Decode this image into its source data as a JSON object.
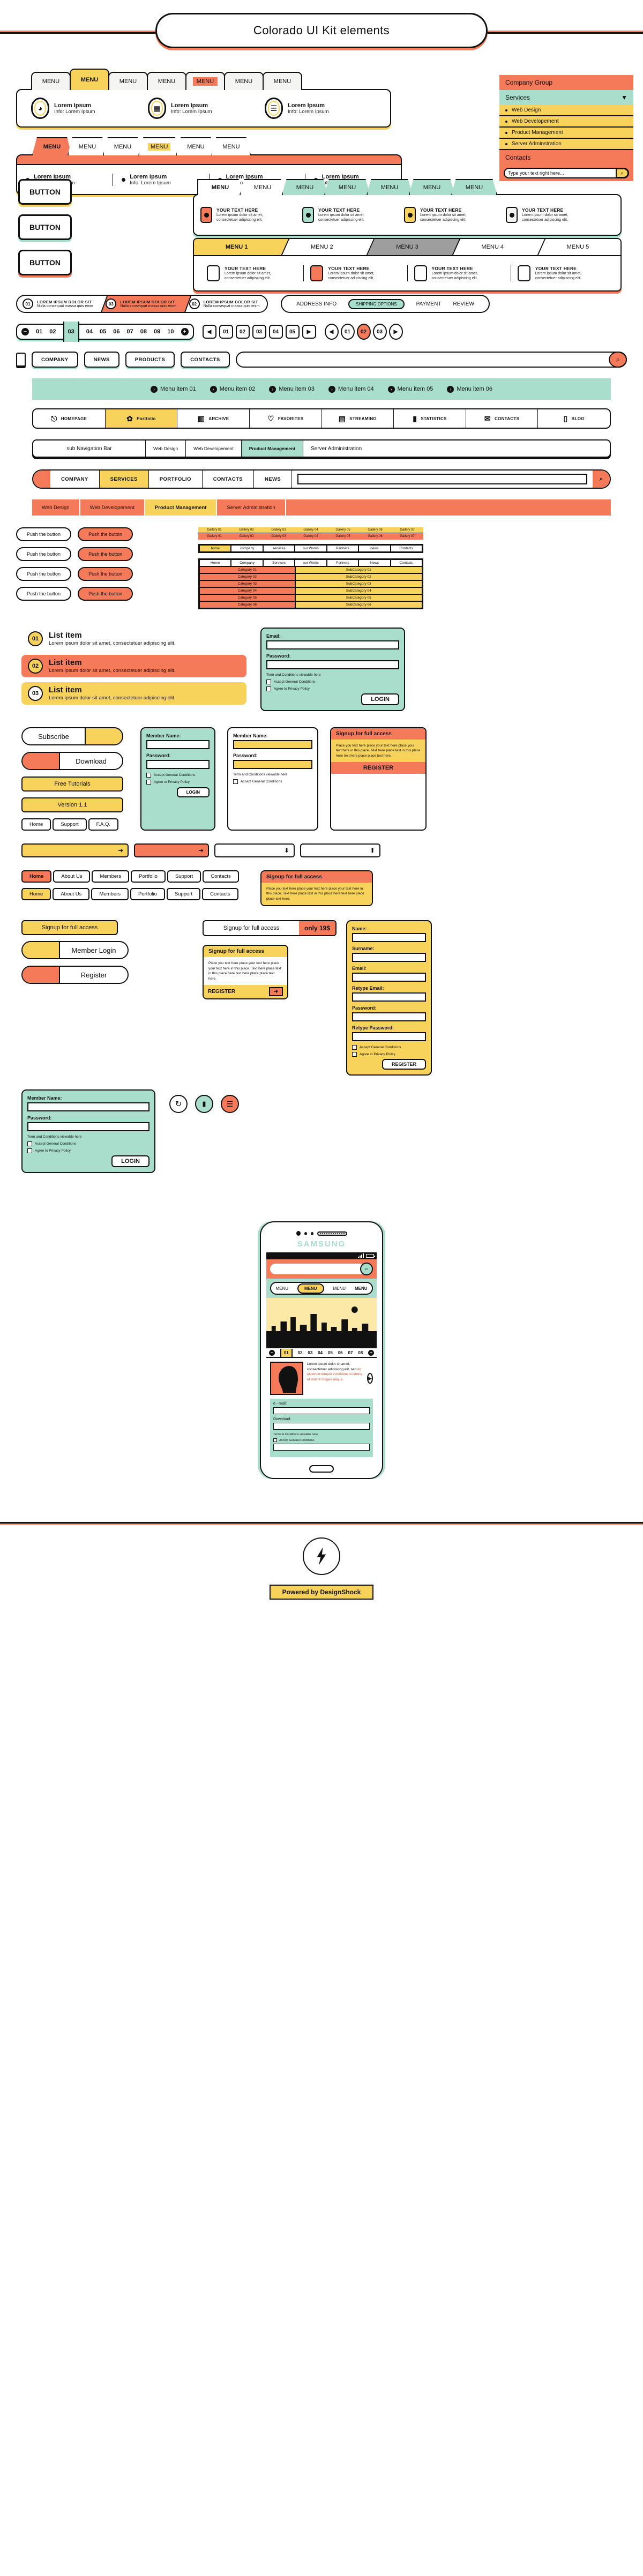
{
  "header": {
    "title": "Colorado UI Kit elements"
  },
  "menu_tabs_yellow": {
    "tabs": [
      "MENU",
      "MENU",
      "MENU",
      "MENU",
      "MENU",
      "MENU",
      "MENU"
    ],
    "selected_index": 1,
    "highlight_index": 4,
    "features": [
      {
        "title": "Lorem Ipsum",
        "info": "Info: Lorem Ipsum",
        "icon": "pie-chart-icon"
      },
      {
        "title": "Lorem Ipsum",
        "info": "Info: Lorem Ipsum",
        "icon": "bar-chart-icon"
      },
      {
        "title": "Lorem Ipsum",
        "info": "Info: Lorem Ipsum",
        "icon": "list-icon"
      }
    ]
  },
  "menu_tabs_orange": {
    "tabs": [
      "MENU",
      "MENU",
      "MENU",
      "MENU",
      "MENU",
      "MENU"
    ],
    "selected_index": 0,
    "highlight_index": 3,
    "features": [
      {
        "title": "Lorem Ipsum",
        "info": "Info: Lorem Ipsum"
      },
      {
        "title": "Lorem Ipsum",
        "info": "Info: Lorem Ipsum"
      },
      {
        "title": "Lorem Ipsum",
        "info": "Info: Lorem Ipsum"
      },
      {
        "title": "Lorem Ipsum",
        "info": "Info: Lorem Ipsum"
      }
    ]
  },
  "company_group": {
    "header": "Company Group",
    "select_label": "Services",
    "options": [
      "Web Design",
      "Web Developement",
      "Product Management",
      "Server Adminstration"
    ],
    "contacts_label": "Contacts",
    "search_placeholder": "Type your text right here..."
  },
  "buttons": {
    "labels": [
      "BUTTON",
      "BUTTON",
      "BUTTON"
    ]
  },
  "menu_tabs_green": {
    "tabs": [
      "MENU",
      "MENU",
      "MENU",
      "MENU",
      "MENU",
      "MENU",
      "MENU"
    ],
    "cells": [
      {
        "heading": "YOUR TEXT HERE",
        "body": "Lorem ipsum dolor sit amet, consectetuer adipiscing elit.",
        "color": "#F47A5A"
      },
      {
        "heading": "YOUR TEXT HERE",
        "body": "Lorem ipsum dolor sit amet, consectetuer adipiscing elit.",
        "color": "#A8DECB"
      },
      {
        "heading": "YOUR TEXT HERE",
        "body": "Lorem ipsum dolor sit amet, consectetuer adipiscing elit.",
        "color": "#F8D35B"
      },
      {
        "heading": "YOUR TEXT HERE",
        "body": "Lorem ipsum dolor sit amet, consectetuer adipiscing elit.",
        "color": "#F4F4F2"
      }
    ]
  },
  "arrow_breadcrumb": {
    "steps": [
      "MENU 1",
      "MENU 2",
      "MENU 3",
      "MENU 4",
      "MENU 5"
    ],
    "active_index": 0,
    "grey_index": 2,
    "cells": [
      {
        "heading": "YOUR TEXT HERE",
        "body": "Lorem ipsum dolor sit amet, consectetuer adipiscing elit.",
        "checked": false
      },
      {
        "heading": "YOUR TEXT HERE",
        "body": "Lorem ipsum dolor sit amet, consectetuer adipiscing elit.",
        "checked": true
      },
      {
        "heading": "YOUR TEXT HERE",
        "body": "Lorem ipsum dolor sit amet, consectetuer adipiscing elit.",
        "checked": false
      },
      {
        "heading": "YOUR TEXT HERE",
        "body": "Lorem ipsum dolor sit amet, consectetuer adipiscing elit.",
        "checked": false
      }
    ]
  },
  "step_ribbon": {
    "steps": [
      {
        "num": "01",
        "title": "LOREM IPSUM DOLOR SIT",
        "sub": "Nulla consequat massa quis enim",
        "active": false
      },
      {
        "num": "03",
        "title": "LOREM IPSUM DOLOR SIT",
        "sub": "Nulla consequat massa quis enim",
        "active": true
      },
      {
        "num": "02",
        "title": "LOREM IPSUM DOLOR SIT",
        "sub": "Nulla consequat massa quis enim",
        "active": false
      }
    ]
  },
  "checkout_steps": {
    "items": [
      "ADDRESS INFO",
      "SHIPPING OPTIONS",
      "PAYMENT",
      "REVIEW"
    ],
    "active_index": 1
  },
  "pagination_main": {
    "minus": "−",
    "plus": "+",
    "pages": [
      "01",
      "02",
      "03",
      "04",
      "05",
      "06",
      "07",
      "08",
      "09",
      "10"
    ],
    "current": "03"
  },
  "pagination_square": {
    "prev": "◀",
    "next": "▶",
    "pages": [
      "01",
      "02",
      "03",
      "04",
      "05"
    ]
  },
  "pagination_oval": {
    "prev": "◀",
    "next": "▶",
    "pages": [
      "01",
      "02",
      "03"
    ],
    "current": "02"
  },
  "nav_buttons": {
    "device_icon": "mobile-icon",
    "items": [
      "COMPANY",
      "NEWS",
      "PRODUCTS",
      "CONTACTS"
    ],
    "search_icon": "search-icon"
  },
  "green_menu_band": {
    "items": [
      "Menu item 01",
      "Menu item 02",
      "Menu item 03",
      "Menu item 04",
      "Menu item 05",
      "Menu item 06"
    ]
  },
  "icon_toolbar": {
    "items": [
      {
        "label": "HOMEPAGE",
        "icon": "door-icon",
        "glyph": "⎘"
      },
      {
        "label": "Portfolio",
        "icon": "portfolio-icon",
        "glyph": "✿"
      },
      {
        "label": "ARCHIVE",
        "icon": "archive-icon",
        "glyph": "▥"
      },
      {
        "label": "FAVORITES",
        "icon": "heart-icon",
        "glyph": "♡"
      },
      {
        "label": "STREAMING",
        "icon": "camera-icon",
        "glyph": "▤"
      },
      {
        "label": "STATISTICS",
        "icon": "chart-icon",
        "glyph": "▮"
      },
      {
        "label": "CONTACTS",
        "icon": "contacts-icon",
        "glyph": "✉"
      },
      {
        "label": "BLOG",
        "icon": "book-icon",
        "glyph": "▯"
      }
    ],
    "active_index": 1
  },
  "sub_navigation": {
    "label": "sub Navigation Bar",
    "items": [
      "Web Design",
      "Web Developement",
      "Product Management"
    ],
    "active_index": 2,
    "rest": "Server Administration"
  },
  "rail_nav": {
    "items": [
      "COMPANY",
      "SERVICES",
      "PORTFOLIO",
      "CONTACTS",
      "NEWS"
    ],
    "active_index": 1,
    "search_icon": "search-icon"
  },
  "orange_strip": {
    "items": [
      "Web Design",
      "Web Developement",
      "Product Management",
      "Server Administration"
    ],
    "active_index": 2
  },
  "push_buttons": {
    "rows": [
      {
        "left": "Push the button",
        "right": "Push the button"
      },
      {
        "left": "Push the button",
        "right": "Push the button"
      },
      {
        "left": "Push the button",
        "right": "Push the button"
      },
      {
        "left": "Push the button",
        "right": "Push the button"
      }
    ]
  },
  "small_table": {
    "headers": [
      "Gallery 01",
      "Gallery 02",
      "Gallery 03",
      "Gallery 04",
      "Gallery 05",
      "Gallery 06",
      "Gallery 07"
    ],
    "cells": [
      "Gallery 01",
      "Gallery 02",
      "Gallery 03",
      "Gallery 04",
      "Gallery 05",
      "Gallery 06",
      "Gallery 07"
    ],
    "row2": [
      "home",
      "company",
      "services",
      "our Works",
      "Partners",
      "news",
      "Contacts"
    ]
  },
  "category_table": {
    "nav": [
      "Home",
      "Company",
      "Services",
      "our Works",
      "Partners",
      "News",
      "Contacts"
    ],
    "left": [
      "Category 01",
      "Category 02",
      "Category 03",
      "Category 04",
      "Category 05",
      "Category 06"
    ],
    "right": [
      "SubCategory 01",
      "SubCategory 02",
      "SubCategory 03",
      "SubCategory 04",
      "SubCategory 05",
      "SubCategory 06"
    ]
  },
  "list_items": [
    {
      "num": "01",
      "title": "List item",
      "body": "Lorem ipsum dolor sit amet, consectetuer adipiscing elit.",
      "bg": "#ffffff"
    },
    {
      "num": "02",
      "title": "List item",
      "body": "Lorem ipsum dolor sit amet, consectetuer adipiscing elit.",
      "bg": "#F47A5A"
    },
    {
      "num": "03",
      "title": "List item",
      "body": "Lorem ipsum dolor sit amet, consectetuer adipiscing elit.",
      "bg": "#F8D35B"
    }
  ],
  "action_buttons": [
    {
      "label": "Subscribe",
      "style": "knob-yellow"
    },
    {
      "label": "Download",
      "style": "knob-orange"
    },
    {
      "label": "Free Tutorials",
      "style": "flat-yellow"
    },
    {
      "label": "Version 1.1",
      "style": "flat-yellow"
    }
  ],
  "home_chips": [
    "Home",
    "Support",
    "F.A.Q."
  ],
  "nav_chip_rows": [
    {
      "items": [
        "Home",
        "About Us",
        "Members",
        "Portfolio",
        "Support",
        "Contacts"
      ],
      "active_index": 0
    },
    {
      "items": [
        "Home",
        "About Us",
        "Members",
        "Portfolio",
        "Support",
        "Contacts"
      ],
      "active_index": 0
    }
  ],
  "login_form": {
    "email_label": "Email:",
    "password_label": "Password:",
    "terms": "Term and Conditions viewable here",
    "accept_general": "Accept General Conditions",
    "agree_privacy": "Agree to Privacy Policy",
    "login_button": "LOGIN"
  },
  "member_form": {
    "title": "Member Name:",
    "password_label": "Password:",
    "terms": "Term and Conditions viewable here",
    "accept_general": "Accept General Conditions",
    "login_button": "LOGIN"
  },
  "register_form": {
    "name_label": "Name:",
    "surname_label": "Surname:",
    "email_label": "Email:",
    "retype_email_label": "Retype Email:",
    "password_label": "Password:",
    "retype_password_label": "Retype Password:",
    "accept_general": "Accept General Conditions",
    "agree_privacy": "Agree to Privacy Policy",
    "register_button": "REGISTER"
  },
  "signup_promo": {
    "header": "Signup for full access",
    "body": "Place you text here place your text here place your text here in this place. Text here place text in this place here text here place place text here.",
    "footer": "REGISTER"
  },
  "signup_banners": {
    "plain": "Signup for full access",
    "priced_label": "Signup for full access",
    "price": "only 19$",
    "member_login": "Member Login",
    "register": "Register"
  },
  "phone": {
    "brand": "SAMSUNG",
    "menu": [
      "MENU",
      "MENU",
      "MENU",
      "MENU"
    ],
    "menu_active_index": 1,
    "pagination": [
      "01",
      "02",
      "03",
      "04",
      "05",
      "06",
      "07",
      "08"
    ],
    "pagination_active": "01",
    "body_text_dark": "Lorem ipsum dolor sit amet, consectetuer adipiscing elit, sed",
    "body_text_red": "do eiusmod tempor incididunt ut labore et dolore magna aliqua.",
    "email_label": "e - mail:",
    "download_label": "Download:",
    "terms": "Terms & Conditions viewable here",
    "accept_general": "Accept General Conditions",
    "search_icon": "search-icon"
  },
  "footer": {
    "logo_icon": "lightning-bolt-icon",
    "powered": "Powered by DesignShock"
  },
  "colors": {
    "orange": "#F47A5A",
    "yellow": "#F8D35B",
    "green": "#A8DECB",
    "grey": "#9E9E9E",
    "ink": "#111111"
  }
}
